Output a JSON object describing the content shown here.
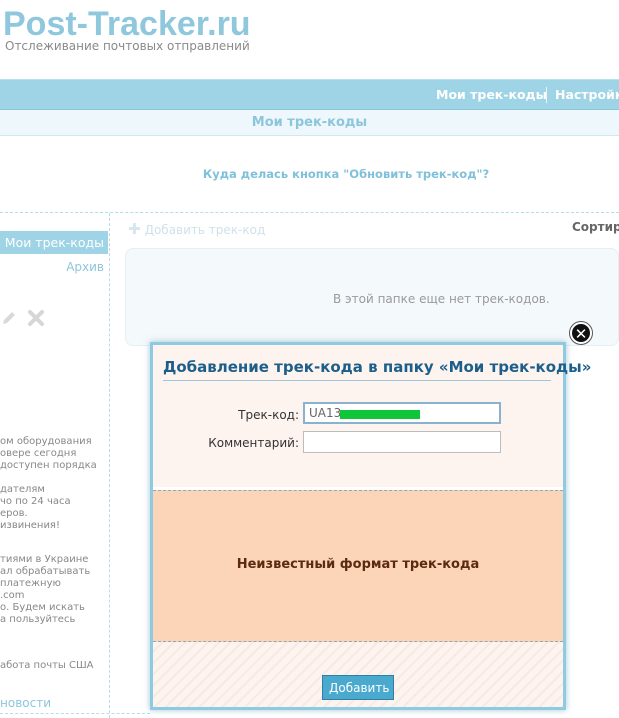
{
  "site": {
    "title": "Post-Tracker.ru",
    "subtitle": "Отслеживание почтовых отправлений"
  },
  "nav": {
    "items": [
      {
        "label": "Мои трек-коды"
      },
      {
        "label": "Настройки"
      }
    ]
  },
  "page": {
    "title": "Мои трек-коды",
    "notice_link": "Куда делась кнопка \"Обновить трек-код\"?"
  },
  "sidebar": {
    "folder_label": "Мои трек-коды",
    "archive_label": "Архив",
    "icons": [
      "pencil-icon",
      "delete-icon"
    ],
    "news_paragraphs": [
      [
        "ом оборудования",
        "овере сегодня",
        "доступен порядка"
      ],
      [
        "дателям",
        "чо по 24 часа",
        "еров.",
        "извинения!"
      ],
      [
        "тиями в Украине",
        "ал обрабатывать",
        "платежную",
        ".com",
        "о. Будем искать",
        "а пользуйтесь"
      ],
      [
        "абота почты США"
      ]
    ],
    "news_link": "новости"
  },
  "main": {
    "add_link": "Добавить трек-код",
    "sort_label": "Сортир",
    "empty_message": "В этой папке еще нет трек-кодов."
  },
  "modal": {
    "title": "Добавление трек-кода в папку «Мои трек-коды»",
    "track_label": "Трек-код:",
    "track_value": "UA13",
    "comment_label": "Комментарий:",
    "comment_value": "",
    "error_message": "Неизвестный формат трек-кода",
    "submit_label": "Добавить",
    "close_symbol": "✕"
  },
  "colors": {
    "accent": "#9fd3e6",
    "logo": "#8fc7dd",
    "error_bg": "#fcd5b8",
    "button": "#4aa9cf"
  }
}
